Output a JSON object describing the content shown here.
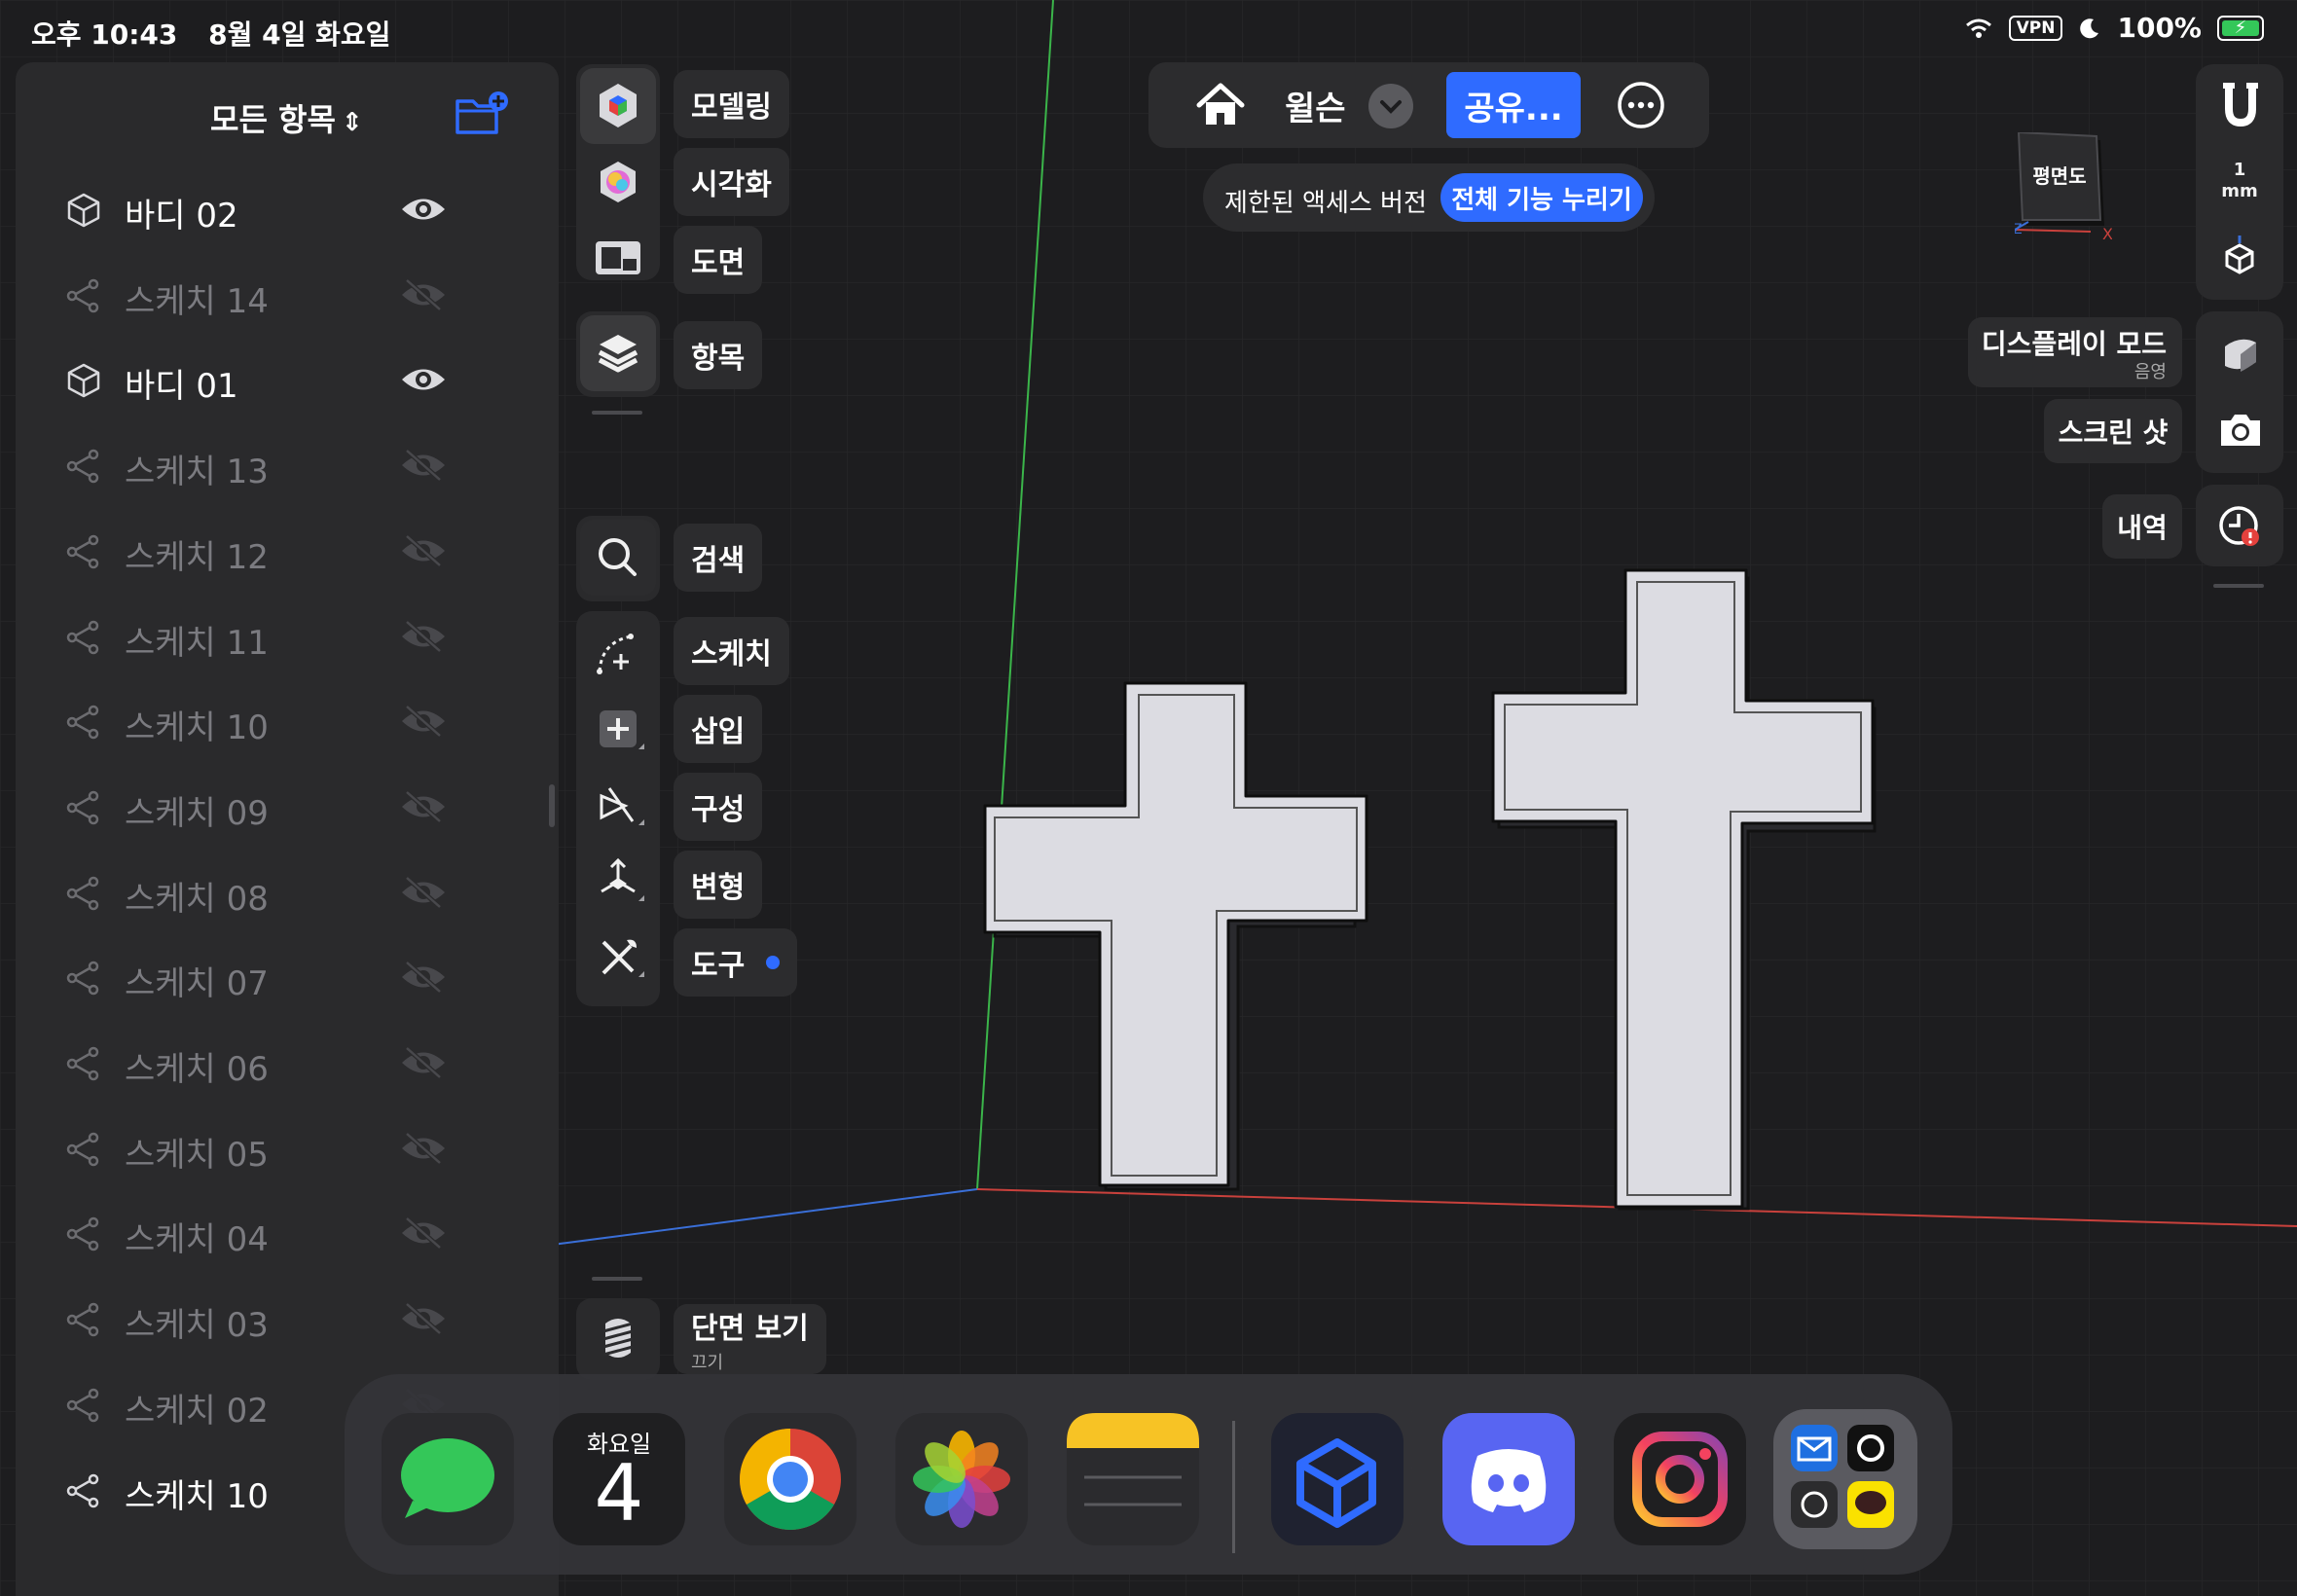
{
  "status_bar": {
    "time": "오후 10:43",
    "date": "8월 4일 화요일",
    "vpn": "VPN",
    "battery": "100%"
  },
  "sidebar": {
    "title": "모든 항목",
    "items": [
      {
        "label": "바디 02",
        "type": "body",
        "visible": true
      },
      {
        "label": "스케치 14",
        "type": "sketch",
        "visible": false
      },
      {
        "label": "바디 01",
        "type": "body",
        "visible": true
      },
      {
        "label": "스케치 13",
        "type": "sketch",
        "visible": false
      },
      {
        "label": "스케치 12",
        "type": "sketch",
        "visible": false
      },
      {
        "label": "스케치 11",
        "type": "sketch",
        "visible": false
      },
      {
        "label": "스케치 10",
        "type": "sketch",
        "visible": false
      },
      {
        "label": "스케치 09",
        "type": "sketch",
        "visible": false
      },
      {
        "label": "스케치 08",
        "type": "sketch",
        "visible": false
      },
      {
        "label": "스케치 07",
        "type": "sketch",
        "visible": false
      },
      {
        "label": "스케치 06",
        "type": "sketch",
        "visible": false
      },
      {
        "label": "스케치 05",
        "type": "sketch",
        "visible": false
      },
      {
        "label": "스케치 04",
        "type": "sketch",
        "visible": false
      },
      {
        "label": "스케치 03",
        "type": "sketch",
        "visible": false
      },
      {
        "label": "스케치 02",
        "type": "sketch",
        "visible": false
      },
      {
        "label": "스케치 10",
        "type": "sketch",
        "visible": true
      }
    ]
  },
  "workspace_tools": [
    {
      "label": "모델링",
      "icon": "modeling-cube-icon"
    },
    {
      "label": "시각화",
      "icon": "visualize-color-icon"
    },
    {
      "label": "도면",
      "icon": "drawing-sheet-icon"
    }
  ],
  "items_tool": {
    "label": "항목",
    "icon": "layers-icon"
  },
  "tools": [
    {
      "label": "검색",
      "icon": "search-icon"
    },
    {
      "label": "스케치",
      "icon": "sketch-icon"
    },
    {
      "label": "삽입",
      "icon": "insert-plus-icon"
    },
    {
      "label": "구성",
      "icon": "construct-icon"
    },
    {
      "label": "변형",
      "icon": "transform-icon"
    },
    {
      "label": "도구",
      "icon": "tools-icon",
      "badge": true
    }
  ],
  "section_view": {
    "label": "단면 보기",
    "sub": "끄기"
  },
  "top_bar": {
    "design_name": "윌슨",
    "share_label": "공유...",
    "limited_text": "제한된 액세스 버전",
    "upgrade_label": "전체 기능 누리기"
  },
  "view_cube": {
    "face": "평면도",
    "axis_x": "X",
    "axis_z": "Z"
  },
  "right_panel": {
    "snap_value": "1",
    "snap_unit": "mm",
    "display_mode_label": "디스플레이 모드",
    "display_mode_value": "음영",
    "screenshot_label": "스크린 샷",
    "history_label": "내역"
  },
  "dock": {
    "calendar_day": "화요일",
    "calendar_date": "4",
    "apps": [
      "messages-icon",
      "calendar-icon",
      "chrome-icon",
      "photos-icon",
      "notes-icon",
      "shapr3d-icon",
      "discord-icon",
      "instagram-icon",
      "app-folder-icon"
    ]
  },
  "colors": {
    "accent": "#2f6bff",
    "panel": "#2a2a2c",
    "viewport": "#1d1d1f",
    "axis_x": "#c9413c",
    "axis_y": "#3bb54a",
    "axis_z": "#3a6fd8",
    "model_fill": "#dcdce2"
  }
}
